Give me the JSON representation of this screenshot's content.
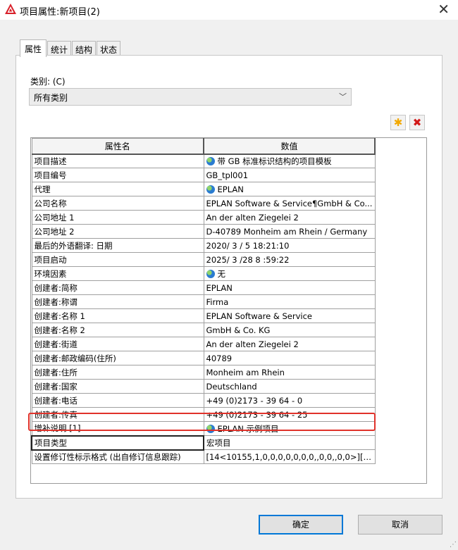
{
  "window": {
    "title": "项目属性:新项目(2)"
  },
  "tabs": [
    "属性",
    "统计",
    "结构",
    "状态"
  ],
  "category": {
    "label": "类别: (C)",
    "value": "所有类别"
  },
  "grid": {
    "headers": {
      "name": "属性名",
      "value": "数值"
    },
    "rows": [
      {
        "name": "项目描述",
        "value": "带 GB 标准标识结构的项目模板",
        "icon": "globe-icon"
      },
      {
        "name": "项目编号",
        "value": "GB_tpl001"
      },
      {
        "name": "代理",
        "value": "EPLAN",
        "icon": "globe-icon"
      },
      {
        "name": "公司名称",
        "value": "EPLAN Software & Service¶GmbH & Co..."
      },
      {
        "name": "公司地址 1",
        "value": "An der alten Ziegelei 2"
      },
      {
        "name": "公司地址 2",
        "value": "D-40789 Monheim am Rhein / Germany"
      },
      {
        "name": "最后的外语翻译: 日期",
        "value": "2020/ 3 / 5  18:21:10"
      },
      {
        "name": "项目启动",
        "value": "2025/ 3 /28  8 :59:22"
      },
      {
        "name": "环境因素",
        "value": "无",
        "icon": "globe-icon"
      },
      {
        "name": "创建者:简称",
        "value": "EPLAN"
      },
      {
        "name": "创建者:称谓",
        "value": "Firma"
      },
      {
        "name": "创建者:名称 1",
        "value": "EPLAN Software & Service"
      },
      {
        "name": "创建者:名称 2",
        "value": "GmbH & Co. KG"
      },
      {
        "name": "创建者:街道",
        "value": "An der alten Ziegelei 2"
      },
      {
        "name": "创建者:邮政编码(住所)",
        "value": "40789"
      },
      {
        "name": "创建者:住所",
        "value": "Monheim am Rhein"
      },
      {
        "name": "创建者:国家",
        "value": "Deutschland"
      },
      {
        "name": "创建者:电话",
        "value": "+49 (0)2173 - 39 64 - 0"
      },
      {
        "name": "创建者:传真",
        "value": "+49 (0)2173 - 39 64 - 25"
      },
      {
        "name": "增补说明 [1]",
        "value": "EPLAN 示例项目",
        "icon": "globe-icon"
      },
      {
        "name": "项目类型",
        "value": "宏项目",
        "selected": true
      },
      {
        "name": "设置修订性标示格式 (出自修订信息跟踪)",
        "value": "[14<10155,1,0,0,0,0,0,0,0,,0,0,,0,0>][LF..."
      }
    ]
  },
  "buttons": {
    "ok": "确定",
    "cancel": "取消"
  },
  "colors": {
    "highlight": "#e0322a",
    "accent": "#0078d7"
  }
}
